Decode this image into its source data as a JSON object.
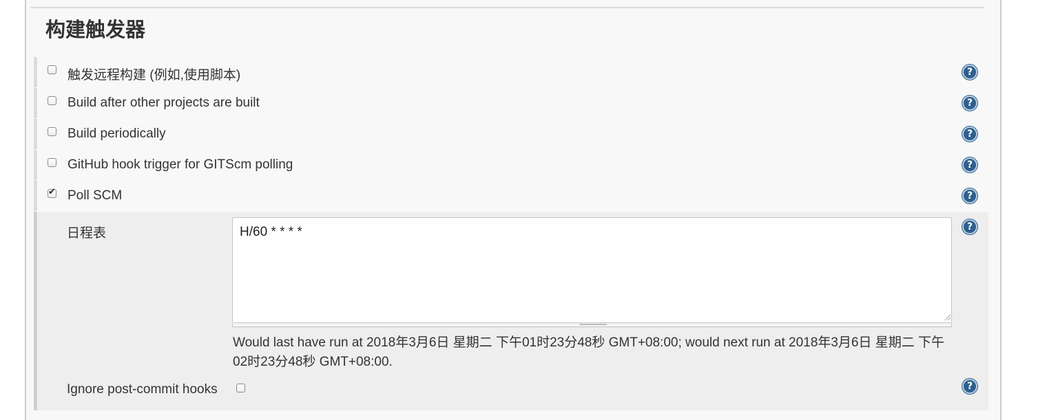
{
  "section": {
    "title": "构建触发器"
  },
  "triggers": [
    {
      "label": "触发远程构建 (例如,使用脚本)",
      "checked": false
    },
    {
      "label": "Build after other projects are built",
      "checked": false
    },
    {
      "label": "Build periodically",
      "checked": false
    },
    {
      "label": "GitHub hook trigger for GITScm polling",
      "checked": false
    },
    {
      "label": "Poll SCM",
      "checked": true
    }
  ],
  "poll_scm": {
    "schedule_label": "日程表",
    "schedule_value": "H/60 * * * *",
    "schedule_info": "Would last have run at 2018年3月6日 星期二 下午01时23分48秒 GMT+08:00; would next run at 2018年3月6日 星期二 下午02时23分48秒 GMT+08:00.",
    "ignore_hooks_label": "Ignore post-commit hooks",
    "ignore_hooks_checked": false
  },
  "help_icon_glyph": "?",
  "colors": {
    "help_icon": "#2e5f8e",
    "panel_bg": "#f8f8f8",
    "subsection_bg": "#eeeeee"
  }
}
